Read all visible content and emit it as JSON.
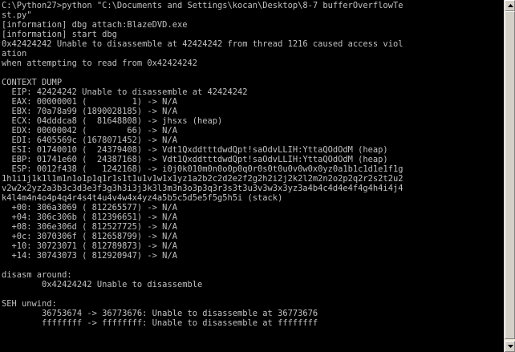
{
  "console": {
    "lines": [
      "C:\\Python27>python \"C:\\Documents and Settings\\kocan\\Desktop\\8-7 bufferOverflowTe",
      "st.py\"",
      "[information] dbg attach:BlazeDVD.exe",
      "[information] start dbg",
      "0x42424242 Unable to disassemble at 42424242 from thread 1216 caused access viol",
      "ation",
      "when attempting to read from 0x42424242",
      "",
      "CONTEXT DUMP",
      "  EIP: 42424242 Unable to disassemble at 42424242",
      "  EAX: 00000001 (         1) -> N/A",
      "  EBX: 70a78a99 (1890028185) -> N/A",
      "  ECX: 04dddca8 (  81648808) -> jhsxs (heap)",
      "  EDX: 00000042 (        66) -> N/A",
      "  EDI: 6405569c (1678071452) -> N/A",
      "  ESI: 01740010 (  24379408) -> Vdt1QxddtttdwdQpt!saOdvLLIH:YttaQOdOdM (heap)",
      "  EBP: 01741e60 (  24387168) -> Vdt1QxddtttdwdQpt!saOdvLLIH:YttaQOdOdM (heap)",
      "  ESP: 0012f438 (   1242168) -> i0j0k010m0n0o0p0q0r0s0t0u0v0w0x0yz0a1b1c1d1e1f1g",
      "1h1i1j1k1l1m1n1o1p1q1r1s1t1u1v1w1x1yz1a2b2c2d2e2f2g2h2i2j2k2l2m2n2o2p2q2r2s2t2u2",
      "v2w2x2yz2a3b3c3d3e3f3g3h3i3j3k3l3m3n3o3p3q3r3s3t3u3v3w3x3yz3a4b4c4d4e4f4g4h4i4j4",
      "k4l4m4n4o4p4q4r4s4t4u4v4w4x4yz4a5b5c5d5e5f5g5h5i (stack)",
      "  +00: 306a3069 ( 812265577) -> N/A",
      "  +04: 306c306b ( 812396651) -> N/A",
      "  +08: 306e306d ( 812527725) -> N/A",
      "  +0c: 3070306f ( 812658799) -> N/A",
      "  +10: 30723071 ( 812789873) -> N/A",
      "  +14: 30743073 ( 812920947) -> N/A",
      "",
      "disasm around:",
      "        0x42424242 Unable to disassemble",
      "",
      "SEH unwind:",
      "        36753674 -> 36773676: Unable to disassemble at 36773676",
      "        ffffffff -> ffffffff: Unable to disassemble at ffffffff",
      "",
      ""
    ]
  },
  "colors": {
    "background": "#000000",
    "text": "#c0c0c0",
    "scrollbar": "#ece9d8"
  }
}
